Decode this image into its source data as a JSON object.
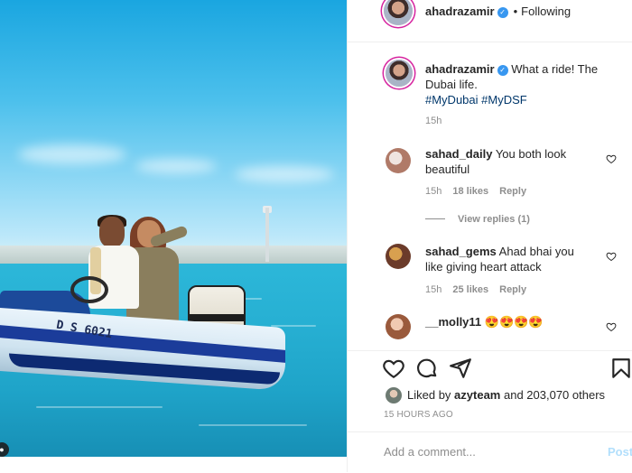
{
  "post": {
    "username": "ahadrazamir",
    "follow_status": "Following",
    "separator": "•"
  },
  "photo": {
    "boat_registration": "D S 6021"
  },
  "caption": {
    "username": "ahadrazamir",
    "text": "What a ride! The Dubai life.",
    "hashtags": "#MyDubai #MyDSF",
    "time": "15h"
  },
  "comments": [
    {
      "username": "sahad_daily",
      "text": "You both look beautiful",
      "time": "15h",
      "likes": "18 likes",
      "reply": "Reply",
      "view_replies": "View replies (1)"
    },
    {
      "username": "sahad_gems",
      "text": "Ahad bhai you like giving heart attack",
      "time": "15h",
      "likes": "25 likes",
      "reply": "Reply"
    },
    {
      "username": "__molly11",
      "text": "😍😍😍😍"
    }
  ],
  "actions": {
    "icons": [
      "heart-icon",
      "comment-icon",
      "share-icon",
      "bookmark-icon"
    ],
    "liked_by_prefix": "Liked by",
    "liked_by_user": "azyteam",
    "liked_by_suffix": "and 203,070 others",
    "posted_ago": "15 HOURS AGO"
  },
  "comment_box": {
    "placeholder": "Add a comment...",
    "post_label": "Post"
  },
  "colors": {
    "accent_link": "#00376b",
    "verified_blue": "#3897f0",
    "post_button_disabled": "#b2dffc",
    "meta_grey": "#8e8e8e"
  }
}
